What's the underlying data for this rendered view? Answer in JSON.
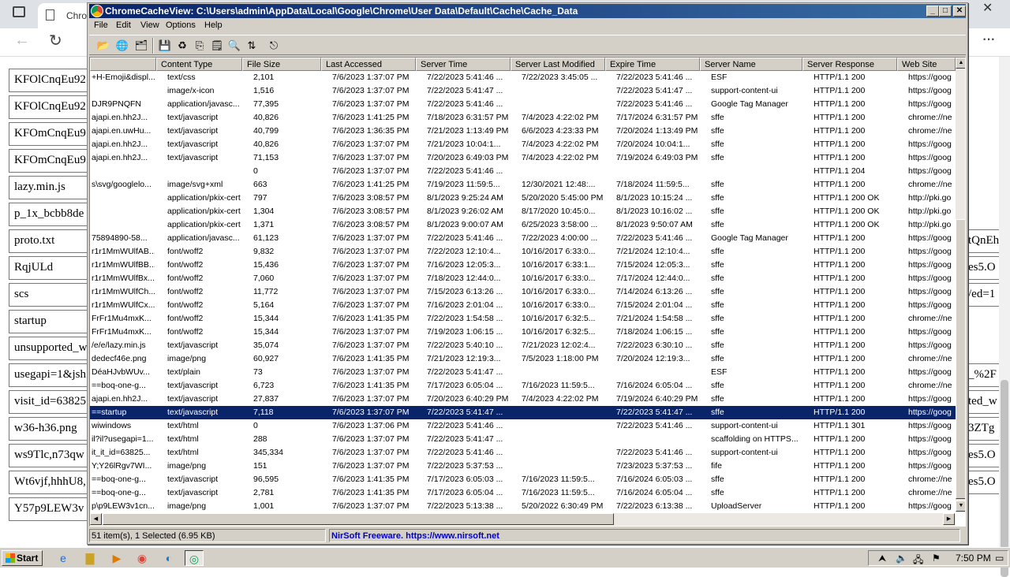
{
  "browser": {
    "tab_title": "Chro",
    "left_items": [
      "KFOlCnqEu92",
      "KFOlCnqEu92",
      "KFOmCnqEu9",
      "KFOmCnqEu9",
      "lazy.min.js",
      "p_1x_bcbb8de",
      "proto.txt",
      "RqjULd",
      "scs",
      "startup",
      "unsupported_w",
      "usegapi=1&jsh",
      "visit_id=63825",
      "w36-h36.png",
      "ws9Tlc,n73qw",
      "Wt6vjf,hhhU8,",
      "Y57p9LEW3v"
    ],
    "right_items": [
      {
        "row": 6,
        "text": "tQnEh"
      },
      {
        "row": 7,
        "text": "es5.O"
      },
      {
        "row": 8,
        "text": "/ed=1"
      },
      {
        "row": 11,
        "text": "_%2F"
      },
      {
        "row": 12,
        "text": "ted_w"
      },
      {
        "row": 13,
        "text": "3ZTg"
      },
      {
        "row": 14,
        "text": "es5.O"
      },
      {
        "row": 15,
        "text": "es5.O"
      }
    ]
  },
  "window": {
    "title": "ChromeCacheView:  C:\\Users\\admin\\AppData\\Local\\Google\\Chrome\\User Data\\Default\\Cache\\Cache_Data",
    "menu": [
      "File",
      "Edit",
      "View",
      "Options",
      "Help"
    ],
    "columns": [
      "",
      "Content Type",
      "File Size",
      "Last Accessed",
      "Server Time",
      "Server Last Modified",
      "Expire Time",
      "Server Name",
      "Server Response",
      "Web Site"
    ],
    "rows": [
      [
        "+H-Emoji&displ...",
        "text/css",
        "2,101",
        "7/6/2023 1:37:07 PM",
        "7/22/2023 5:41:46 ...",
        "7/22/2023 3:45:05 ...",
        "7/22/2023 5:41:46 ...",
        "ESF",
        "HTTP/1.1 200",
        "https://goog"
      ],
      [
        "",
        "image/x-icon",
        "1,516",
        "7/6/2023 1:37:07 PM",
        "7/22/2023 5:41:47 ...",
        "",
        "7/22/2023 5:41:47 ...",
        "support-content-ui",
        "HTTP/1.1 200",
        "https://goog"
      ],
      [
        "DJR9PNQFN",
        "application/javasc...",
        "77,395",
        "7/6/2023 1:37:07 PM",
        "7/22/2023 5:41:46 ...",
        "",
        "7/22/2023 5:41:46 ...",
        "Google Tag Manager",
        "HTTP/1.1 200",
        "https://goog"
      ],
      [
        "ajapi.en.hh2J...",
        "text/javascript",
        "40,826",
        "7/6/2023 1:41:25 PM",
        "7/18/2023 6:31:57 PM",
        "7/4/2023 4:22:02 PM",
        "7/17/2024 6:31:57 PM",
        "sffe",
        "HTTP/1.1 200",
        "chrome://ne"
      ],
      [
        "ajapi.en.uwHu...",
        "text/javascript",
        "40,799",
        "7/6/2023 1:36:35 PM",
        "7/21/2023 1:13:49 PM",
        "6/6/2023 4:23:33 PM",
        "7/20/2024 1:13:49 PM",
        "sffe",
        "HTTP/1.1 200",
        "chrome://ne"
      ],
      [
        "ajapi.en.hh2J...",
        "text/javascript",
        "40,826",
        "7/6/2023 1:37:07 PM",
        "7/21/2023 10:04:1...",
        "7/4/2023 4:22:02 PM",
        "7/20/2024 10:04:1...",
        "sffe",
        "HTTP/1.1 200",
        "https://goog"
      ],
      [
        "ajapi.en.hh2J...",
        "text/javascript",
        "71,153",
        "7/6/2023 1:37:07 PM",
        "7/20/2023 6:49:03 PM",
        "7/4/2023 4:22:02 PM",
        "7/19/2024 6:49:03 PM",
        "sffe",
        "HTTP/1.1 200",
        "https://goog"
      ],
      [
        "",
        "",
        "0",
        "7/6/2023 1:37:07 PM",
        "7/22/2023 5:41:46 ...",
        "",
        "",
        "",
        "HTTP/1.1 204",
        "https://goog"
      ],
      [
        "s\\svg/googlelo...",
        "image/svg+xml",
        "663",
        "7/6/2023 1:41:25 PM",
        "7/19/2023 11:59:5...",
        "12/30/2021 12:48:...",
        "7/18/2024 11:59:5...",
        "sffe",
        "HTTP/1.1 200",
        "chrome://ne"
      ],
      [
        "",
        "application/pkix-cert",
        "797",
        "7/6/2023 3:08:57 PM",
        "8/1/2023 9:25:24 AM",
        "5/20/2020 5:45:00 PM",
        "8/1/2023 10:15:24 ...",
        "sffe",
        "HTTP/1.1 200 OK",
        "http://pki.go"
      ],
      [
        "",
        "application/pkix-cert",
        "1,304",
        "7/6/2023 3:08:57 PM",
        "8/1/2023 9:26:02 AM",
        "8/17/2020 10:45:0...",
        "8/1/2023 10:16:02 ...",
        "sffe",
        "HTTP/1.1 200 OK",
        "http://pki.go"
      ],
      [
        "",
        "application/pkix-cert",
        "1,371",
        "7/6/2023 3:08:57 PM",
        "8/1/2023 9:00:07 AM",
        "6/25/2023 3:58:00 ...",
        "8/1/2023 9:50:07 AM",
        "sffe",
        "HTTP/1.1 200 OK",
        "http://pki.go"
      ],
      [
        "75894890-58...",
        "application/javasc...",
        "61,123",
        "7/6/2023 1:37:07 PM",
        "7/22/2023 5:41:46 ...",
        "7/22/2023 4:00:00 ...",
        "7/22/2023 5:41:46 ...",
        "Google Tag Manager",
        "HTTP/1.1 200",
        "https://goog"
      ],
      [
        "r1r1MmWUlfAB...",
        "font/woff2",
        "9,832",
        "7/6/2023 1:37:07 PM",
        "7/22/2023 12:10:4...",
        "10/16/2017 6:33:0...",
        "7/21/2024 12:10:4...",
        "sffe",
        "HTTP/1.1 200",
        "https://goog"
      ],
      [
        "r1r1MmWUlfBB...",
        "font/woff2",
        "15,436",
        "7/6/2023 1:37:07 PM",
        "7/16/2023 12:05:3...",
        "10/16/2017 6:33:1...",
        "7/15/2024 12:05:3...",
        "sffe",
        "HTTP/1.1 200",
        "https://goog"
      ],
      [
        "r1r1MmWUlfBx...",
        "font/woff2",
        "7,060",
        "7/6/2023 1:37:07 PM",
        "7/18/2023 12:44:0...",
        "10/16/2017 6:33:0...",
        "7/17/2024 12:44:0...",
        "sffe",
        "HTTP/1.1 200",
        "https://goog"
      ],
      [
        "r1r1MmWUlfCh...",
        "font/woff2",
        "11,772",
        "7/6/2023 1:37:07 PM",
        "7/15/2023 6:13:26 ...",
        "10/16/2017 6:33:0...",
        "7/14/2024 6:13:26 ...",
        "sffe",
        "HTTP/1.1 200",
        "https://goog"
      ],
      [
        "r1r1MmWUlfCx...",
        "font/woff2",
        "5,164",
        "7/6/2023 1:37:07 PM",
        "7/16/2023 2:01:04 ...",
        "10/16/2017 6:33:0...",
        "7/15/2024 2:01:04 ...",
        "sffe",
        "HTTP/1.1 200",
        "https://goog"
      ],
      [
        "FrFr1Mu4mxK...",
        "font/woff2",
        "15,344",
        "7/6/2023 1:41:35 PM",
        "7/22/2023 1:54:58 ...",
        "10/16/2017 6:32:5...",
        "7/21/2024 1:54:58 ...",
        "sffe",
        "HTTP/1.1 200",
        "chrome://ne"
      ],
      [
        "FrFr1Mu4mxK...",
        "font/woff2",
        "15,344",
        "7/6/2023 1:37:07 PM",
        "7/19/2023 1:06:15 ...",
        "10/16/2017 6:32:5...",
        "7/18/2024 1:06:15 ...",
        "sffe",
        "HTTP/1.1 200",
        "https://goog"
      ],
      [
        "/e/e/lazy.min.js",
        "text/javascript",
        "35,074",
        "7/6/2023 1:37:07 PM",
        "7/22/2023 5:40:10 ...",
        "7/21/2023 12:02:4...",
        "7/22/2023 6:30:10 ...",
        "sffe",
        "HTTP/1.1 200",
        "https://goog"
      ],
      [
        "dedecf46e.png",
        "image/png",
        "60,927",
        "7/6/2023 1:41:35 PM",
        "7/21/2023 12:19:3...",
        "7/5/2023 1:18:00 PM",
        "7/20/2024 12:19:3...",
        "sffe",
        "HTTP/1.1 200",
        "chrome://ne"
      ],
      [
        "DéaHJvbWUv...",
        "text/plain",
        "73",
        "7/6/2023 1:37:07 PM",
        "7/22/2023 5:41:47 ...",
        "",
        "",
        "ESF",
        "HTTP/1.1 200",
        "https://goog"
      ],
      [
        "==boq-one-g...",
        "text/javascript",
        "6,723",
        "7/6/2023 1:41:35 PM",
        "7/17/2023 6:05:04 ...",
        "7/16/2023 11:59:5...",
        "7/16/2024 6:05:04 ...",
        "sffe",
        "HTTP/1.1 200",
        "chrome://ne"
      ],
      [
        "ajapi.en.hh2J...",
        "text/javascript",
        "27,837",
        "7/6/2023 1:37:07 PM",
        "7/20/2023 6:40:29 PM",
        "7/4/2023 4:22:02 PM",
        "7/19/2024 6:40:29 PM",
        "sffe",
        "HTTP/1.1 200",
        "https://goog"
      ],
      [
        "==startup",
        "text/javascript",
        "7,118",
        "7/6/2023 1:37:07 PM",
        "7/22/2023 5:41:47 ...",
        "",
        "7/22/2023 5:41:47 ...",
        "sffe",
        "HTTP/1.1 200",
        "https://goog"
      ],
      [
        "wiwindows",
        "text/html",
        "0",
        "7/6/2023 1:37:06 PM",
        "7/22/2023 5:41:46 ...",
        "",
        "7/22/2023 5:41:46 ...",
        "support-content-ui",
        "HTTP/1.1 301",
        "https://goog"
      ],
      [
        "il?il?usegapi=1...",
        "text/html",
        "288",
        "7/6/2023 1:37:07 PM",
        "7/22/2023 5:41:47 ...",
        "",
        "",
        "scaffolding on HTTPS...",
        "HTTP/1.1 200",
        "https://goog"
      ],
      [
        "it_it_id=63825...",
        "text/html",
        "345,334",
        "7/6/2023 1:37:07 PM",
        "7/22/2023 5:41:46 ...",
        "",
        "7/22/2023 5:41:46 ...",
        "support-content-ui",
        "HTTP/1.1 200",
        "https://goog"
      ],
      [
        "Y;Y26lRgv7WI...",
        "image/png",
        "151",
        "7/6/2023 1:37:07 PM",
        "7/22/2023 5:37:53 ...",
        "",
        "7/23/2023 5:37:53 ...",
        "fife",
        "HTTP/1.1 200",
        "https://goog"
      ],
      [
        "==boq-one-g...",
        "text/javascript",
        "96,595",
        "7/6/2023 1:41:35 PM",
        "7/17/2023 6:05:03 ...",
        "7/16/2023 11:59:5...",
        "7/16/2024 6:05:03 ...",
        "sffe",
        "HTTP/1.1 200",
        "chrome://ne"
      ],
      [
        "==boq-one-g...",
        "text/javascript",
        "2,781",
        "7/6/2023 1:41:35 PM",
        "7/17/2023 6:05:04 ...",
        "7/16/2023 11:59:5...",
        "7/16/2024 6:05:04 ...",
        "sffe",
        "HTTP/1.1 200",
        "chrome://ne"
      ],
      [
        "p\\p9LEW3v1cn...",
        "image/png",
        "1,001",
        "7/6/2023 1:37:07 PM",
        "7/22/2023 5:13:38 ...",
        "5/20/2022 6:30:49 PM",
        "7/22/2023 6:13:38 ...",
        "UploadServer",
        "HTTP/1.1 200",
        "https://goog"
      ]
    ],
    "selected_row": 25,
    "status": {
      "count": "51 item(s), 1 Selected  (6.95 KB)",
      "link": "NirSoft Freeware. https://www.nirsoft.net"
    }
  },
  "taskbar": {
    "start_label": "Start",
    "clock": "7:50 PM"
  }
}
